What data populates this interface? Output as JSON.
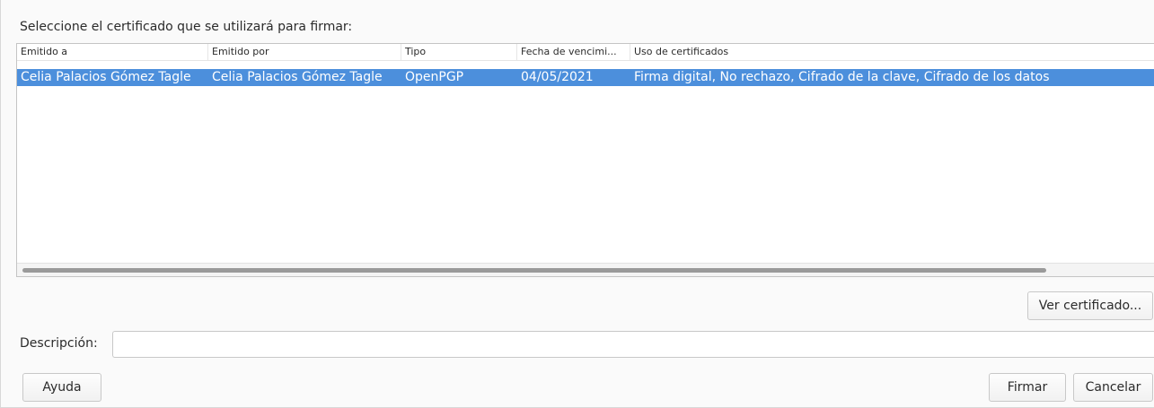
{
  "dialog": {
    "prompt": "Seleccione el certificado que se utilizará para firmar:"
  },
  "cert_table": {
    "columns": [
      "Emitido a",
      "Emitido por",
      "Tipo",
      "Fecha de vencimi...",
      "Uso de certificados"
    ],
    "rows": [
      {
        "issued_to": "Celia Palacios Gómez Tagle",
        "issued_by": "Celia Palacios Gómez Tagle",
        "type": "OpenPGP",
        "expiry": "04/05/2021",
        "usage": "Firma digital, No rechazo, Cifrado de la clave, Cifrado de los datos",
        "selected": true
      }
    ]
  },
  "buttons": {
    "view_certificate": "Ver certificado...",
    "help": "Ayuda",
    "sign": "Firmar",
    "cancel": "Cancelar"
  },
  "description": {
    "label": "Descripción:",
    "value": "",
    "placeholder": ""
  },
  "colors": {
    "selection": "#4c8fdc",
    "selection_text": "#ffffff",
    "window_bg": "#fafafa"
  }
}
